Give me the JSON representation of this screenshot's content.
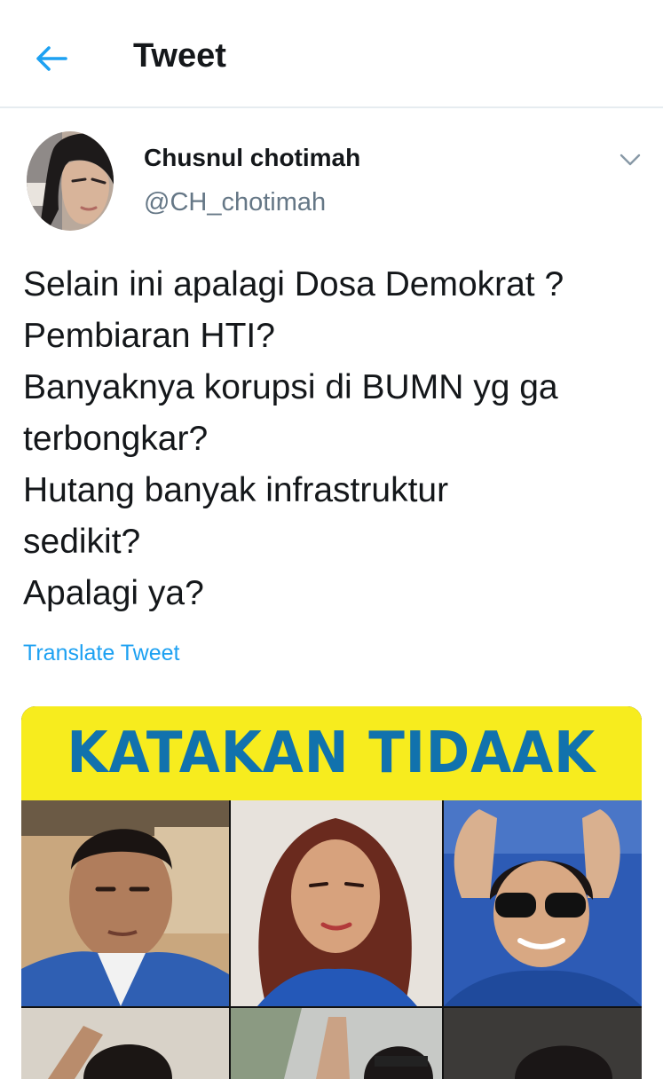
{
  "header": {
    "back_icon": "arrow-left-icon",
    "title": "Tweet"
  },
  "author": {
    "name": "Chusnul chotimah",
    "handle": "@CH_chotimah",
    "menu_icon": "chevron-down-icon"
  },
  "tweet": {
    "lines": [
      "Selain ini apalagi Dosa Demokrat ?",
      "Pembiaran HTI?",
      "Banyaknya korupsi di BUMN yg ga",
      "terbongkar?",
      "Hutang banyak infrastruktur",
      "sedikit?",
      "Apalagi ya?"
    ],
    "translate_label": "Translate Tweet"
  },
  "media": {
    "banner_text": "KATAKAN TIDAAK"
  },
  "colors": {
    "accent": "#1da1f2",
    "secondary_text": "#657786",
    "banner_bg": "#f7ec1e",
    "banner_text": "#1172ad"
  }
}
